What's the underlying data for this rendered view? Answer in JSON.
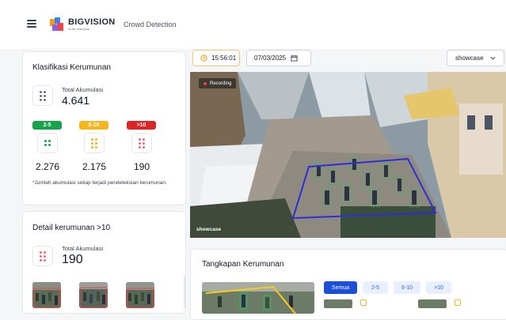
{
  "header": {
    "brand": "BIGVISION",
    "brand_sub": "AI for everyone",
    "app_title": "Crowd Detection"
  },
  "klasifikasi": {
    "title": "Klasifikasi Kerumunan",
    "total_label": "Total Akumulasi",
    "total_value": "4.641",
    "categories": [
      {
        "label": "2-5",
        "value": "2.276",
        "color": "#16a34a",
        "dot_color": "#16a34a"
      },
      {
        "label": "6-10",
        "value": "2.175",
        "color": "#f5b51c",
        "dot_color": "#f5b51c"
      },
      {
        "label": ">10",
        "value": "190",
        "color": "#dc2626",
        "dot_color": "#ef6b6b"
      }
    ],
    "note": "*Jumlah akumulasi setiap terjadi pendeteksian kerumunan."
  },
  "detail": {
    "title": "Detail kerumunan >10",
    "total_label": "Total Akumulasi",
    "total_value": "190"
  },
  "controls": {
    "time": "15:56:01",
    "date": "07/03/2025",
    "camera_select": "showcase"
  },
  "video": {
    "recording_label": "Recording",
    "camera_label": "showcase"
  },
  "tangkapan": {
    "title": "Tangkapan Kerumunan",
    "filters": [
      "Semua",
      "2-5",
      "6-10",
      ">10"
    ],
    "active_filter": "Semua"
  },
  "colors": {
    "accent": "#2563eb",
    "detection_box": "#2d2fd6",
    "person_box": "#22c55e"
  },
  "icons": {
    "menu": "hamburger-icon",
    "time": "clock-icon",
    "date": "calendar-icon",
    "select": "chevron-down-icon",
    "crowd": "crowd-dots-icon"
  }
}
